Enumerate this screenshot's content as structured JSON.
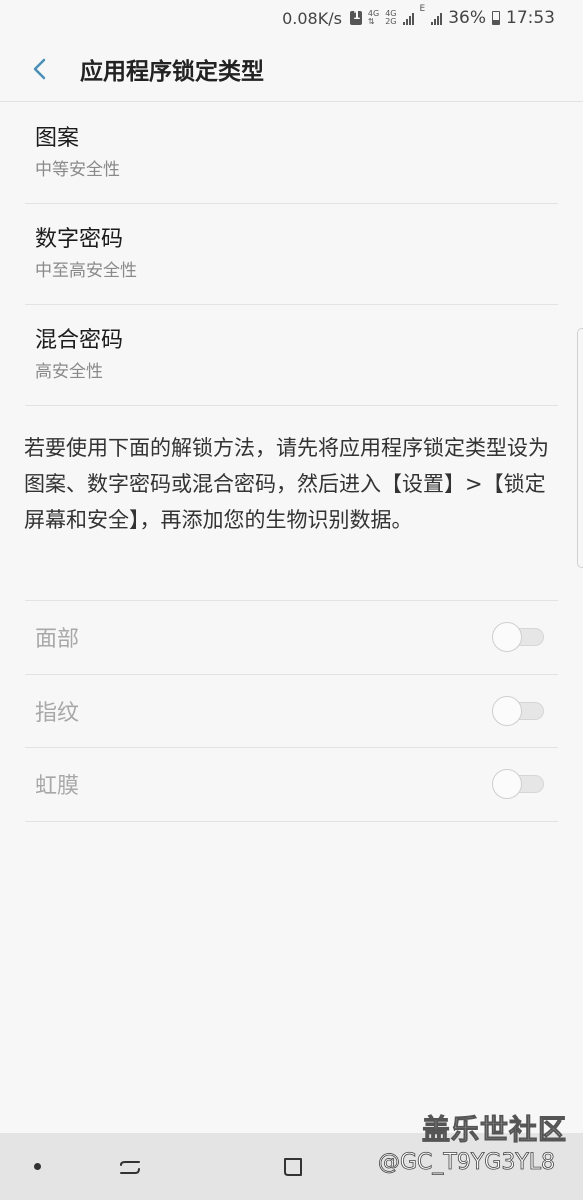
{
  "status_bar": {
    "speed": "0.08K/s",
    "net_top": "4G",
    "net_mid": "4G",
    "net_bot": "2G",
    "net_e": "E",
    "battery_pct": "36%",
    "time": "17:53"
  },
  "header": {
    "title": "应用程序锁定类型"
  },
  "lock_types": [
    {
      "title": "图案",
      "subtitle": "中等安全性"
    },
    {
      "title": "数字密码",
      "subtitle": "中至高安全性"
    },
    {
      "title": "混合密码",
      "subtitle": "高安全性"
    }
  ],
  "info_text": "若要使用下面的解锁方法，请先将应用程序锁定类型设为图案、数字密码或混合密码，然后进入【设置】>【锁定屏幕和安全】，再添加您的生物识别数据。",
  "biometrics": [
    {
      "label": "面部",
      "enabled": false
    },
    {
      "label": "指纹",
      "enabled": false
    },
    {
      "label": "虹膜",
      "enabled": false
    }
  ],
  "watermark": {
    "site": "盖乐世社区",
    "user": "@GC_T9YG3YL8"
  },
  "colors": {
    "background": "#f7f7f7",
    "accent": "#4a8fb8",
    "disabled_text": "#a8a8a8"
  }
}
